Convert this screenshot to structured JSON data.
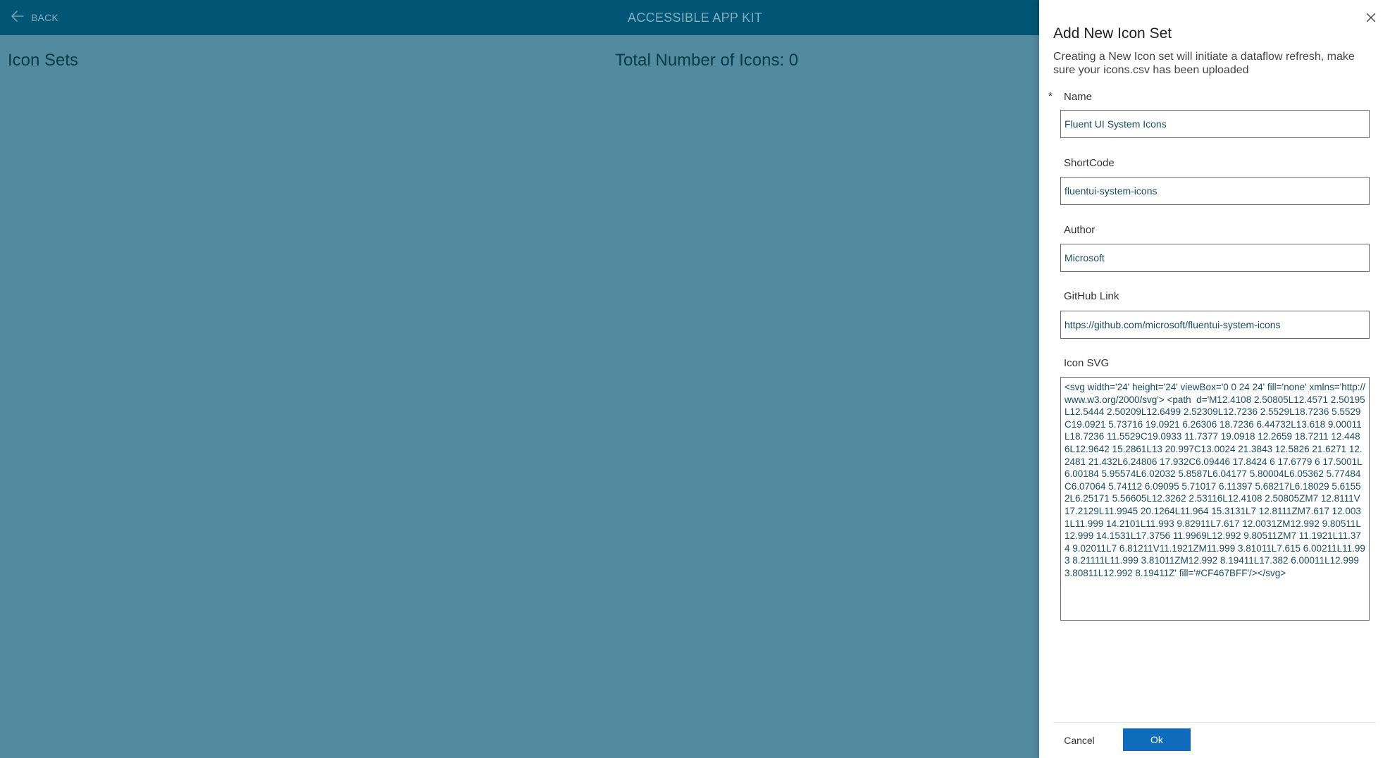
{
  "header": {
    "back_label": "BACK",
    "app_title": "ACCESSIBLE APP KIT"
  },
  "main": {
    "section_title": "Icon Sets",
    "total_label": "Total Number of Icons: 0"
  },
  "panel": {
    "title": "Add New Icon Set",
    "subtitle": "Creating a New Icon set will initiate a dataflow refresh, make sure your icons.csv has been uploaded",
    "required_marker": "*",
    "fields": {
      "name": {
        "label": "Name",
        "value": "Fluent UI System Icons"
      },
      "shortcode": {
        "label": "ShortCode",
        "value": "fluentui-system-icons"
      },
      "author": {
        "label": "Author",
        "value": "Microsoft"
      },
      "github": {
        "label": "GitHub Link",
        "value": "https://github.com/microsoft/fluentui-system-icons"
      },
      "icon_svg": {
        "label": "Icon SVG",
        "value": "<svg width='24' height='24' viewBox='0 0 24 24' fill='none' xmlns='http://www.w3.org/2000/svg'> <path  d='M12.4108 2.50805L12.4571 2.50195L12.5444 2.50209L12.6499 2.52309L12.7236 2.5529L18.7236 5.5529C19.0921 5.73716 19.0921 6.26306 18.7236 6.44732L13.618 9.00011L18.7236 11.5529C19.0933 11.7377 19.0918 12.2659 18.7211 12.4486L12.9642 15.2861L13 20.997C13.0024 21.3843 12.5826 21.6271 12.2481 21.432L6.24806 17.932C6.09446 17.8424 6 17.6779 6 17.5001L6.00184 5.95574L6.02032 5.8587L6.04177 5.80004L6.05362 5.77484C6.07064 5.74112 6.09095 5.71017 6.11397 5.68217L6.18029 5.61552L6.25171 5.56605L12.3262 2.53116L12.4108 2.50805ZM7 12.8111V17.2129L11.9945 20.1264L11.964 15.3131L7 12.8111ZM7.617 12.0031L11.999 14.2101L11.993 9.82911L7.617 12.0031ZM12.992 9.80511L12.999 14.1531L17.3756 11.9969L12.992 9.80511ZM7 11.1921L11.374 9.02011L7 6.81211V11.1921ZM11.999 3.81011L7.615 6.00211L11.993 8.21111L11.999 3.81011ZM12.992 8.19411L17.382 6.00011L12.999 3.80811L12.992 8.19411Z' fill='#CF467BFF'/></svg>"
      }
    },
    "cancel_label": "Cancel",
    "ok_label": "Ok"
  },
  "colors": {
    "overlay": "#518b9d",
    "header": "#025574",
    "primary_button": "#0f6cbd"
  },
  "icons": {
    "back": "arrow-left-icon",
    "close": "close-icon"
  }
}
